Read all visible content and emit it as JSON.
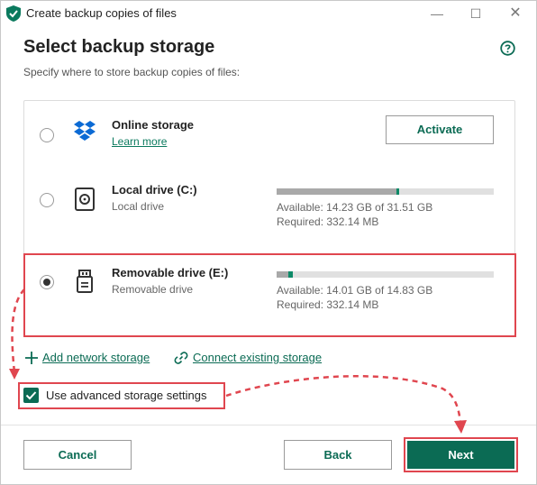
{
  "window": {
    "title": "Create backup copies of files",
    "minimize_glyph": "—",
    "maximize_glyph": "☐",
    "close_glyph": "✕",
    "shield_icon": "shield-check-icon"
  },
  "header": {
    "title": "Select backup storage",
    "subtitle": "Specify where to store backup copies of files:",
    "help_icon": "help-icon"
  },
  "storage": {
    "items": [
      {
        "title": "Online storage",
        "link": "Learn more",
        "button": "Activate",
        "icon": "dropbox-icon",
        "selected": false
      },
      {
        "title": "Local drive (C:)",
        "subtitle": "Local drive",
        "available": "Available: 14.23 GB of 31.51 GB",
        "required": "Required: 332.14 MB",
        "icon": "hard-drive-icon",
        "used_fraction": 0.55,
        "required_fraction": 0.01,
        "selected": false
      },
      {
        "title": "Removable drive (E:)",
        "subtitle": "Removable drive",
        "available": "Available: 14.01 GB of 14.83 GB",
        "required": "Required: 332.14 MB",
        "icon": "usb-drive-icon",
        "used_fraction": 0.055,
        "required_fraction": 0.022,
        "selected": true
      }
    ]
  },
  "actions": {
    "add_network": "Add network storage",
    "connect_existing": "Connect existing storage"
  },
  "advanced": {
    "label": "Use advanced storage settings",
    "checked": true
  },
  "footer": {
    "cancel": "Cancel",
    "back": "Back",
    "next": "Next"
  },
  "colors": {
    "accent": "#0b6b54",
    "highlight": "#e0464f",
    "bar_used": "#a9a9a9",
    "bar_required": "#0e8a68"
  }
}
